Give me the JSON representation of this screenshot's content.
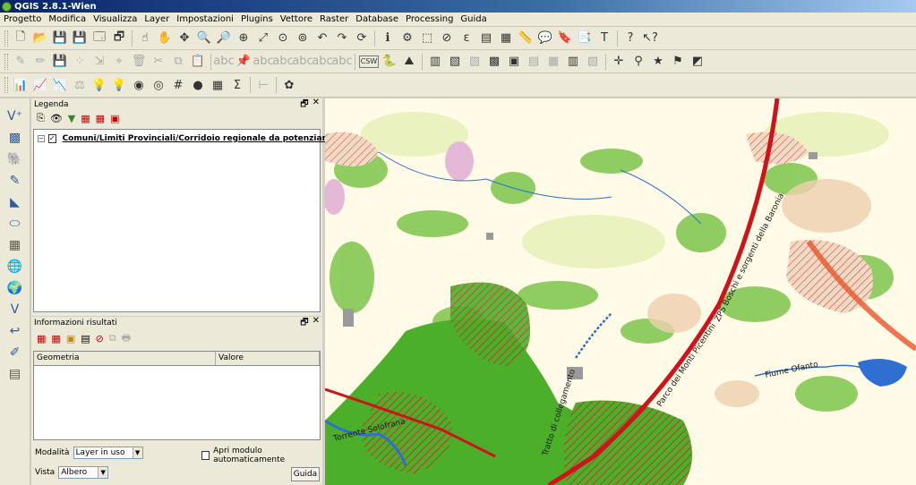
{
  "window": {
    "title": "QGIS 2.8.1-Wien"
  },
  "menubar": {
    "items": [
      "Progetto",
      "Modifica",
      "Visualizza",
      "Layer",
      "Impostazioni",
      "Plugins",
      "Vettore",
      "Raster",
      "Database",
      "Processing",
      "Guida"
    ]
  },
  "toolbar": {
    "csw_label": "CSW"
  },
  "legend": {
    "title": "Legenda",
    "layer_label": "Comuni/Limiti Provinciali/Corridoio regionale da potenziar..."
  },
  "info": {
    "title": "Informazioni risultati",
    "columns": [
      "Geometria",
      "Valore"
    ],
    "mode_label": "Modalità",
    "mode_value": "Layer in uso",
    "auto_open_label": "Apri modulo automaticamente",
    "view_label": "Vista",
    "view_value": "Albero",
    "help_button": "Guida"
  },
  "map": {
    "labels": {
      "corridor": "ZPS Boschi e sorgenti della Baronia",
      "park": "Parco dei Monti Picentini",
      "river_ofanto": "Fiume Ofanto",
      "torrent": "Torrente Solofrana",
      "tratturo": "Tratto di collegamento"
    },
    "colors": {
      "corridor_red": "#d0121b",
      "forest_green": "#4caf2a",
      "hatch_red": "#c0392b",
      "river_blue": "#2f6fd1",
      "background": "#fffbe6"
    }
  }
}
